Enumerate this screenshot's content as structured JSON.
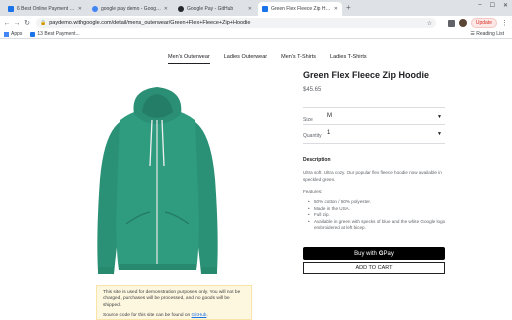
{
  "browser": {
    "tabs": [
      {
        "title": "6 Best Online Payment System",
        "color": "#1a73e8"
      },
      {
        "title": "google pay demo - Google Se",
        "color": "#4285f4"
      },
      {
        "title": "Google Pay - GitHub",
        "color": "#24292e"
      },
      {
        "title": "Green Flex Fleece Zip Hoodie",
        "color": "#1a73e8",
        "active": true
      }
    ],
    "new_tab_icon": "plus-icon",
    "url": "paydemo.withgoogle.com/detail/mens_outerwear/Green+Flex+Fleece+Zip+Hoodie",
    "update_label": "Update",
    "bookmarks": [
      {
        "label": "Apps"
      },
      {
        "label": "13 Best Payment..."
      }
    ],
    "reading_list": "Reading List"
  },
  "nav": {
    "categories": [
      "Men's Outerwear",
      "Ladies Outerwear",
      "Men's T-Shirts",
      "Ladies T-Shirts"
    ],
    "active_index": 0
  },
  "product": {
    "title": "Green Flex Fleece Zip Hoodie",
    "price": "$45.65",
    "color": "#2f9c7f",
    "size_label": "Size",
    "size_value": "M",
    "quantity_label": "Quantity",
    "quantity_value": "1",
    "description_heading": "Description",
    "description": "Ultra soft. Ultra cozy. Our popular flex fleece hoodie now available in speckled green.",
    "features_heading": "Features:",
    "features": [
      "50% cotton / 50% polyester.",
      "Made in the USA.",
      "Full zip.",
      "Available in green with specks of blue and the white Google logo embroidered at left bicep."
    ],
    "buy_with_label": "Buy with",
    "gpay_label": "Pay",
    "add_to_cart_label": "ADD TO CART"
  },
  "notice": {
    "text": "This site is used for demonstration purposes only. You will not be charged, purchases will be processed, and no goods will be shipped.",
    "source_prefix": "Source code for this site can be found on",
    "source_link": "GitHub",
    "source_suffix": "."
  }
}
